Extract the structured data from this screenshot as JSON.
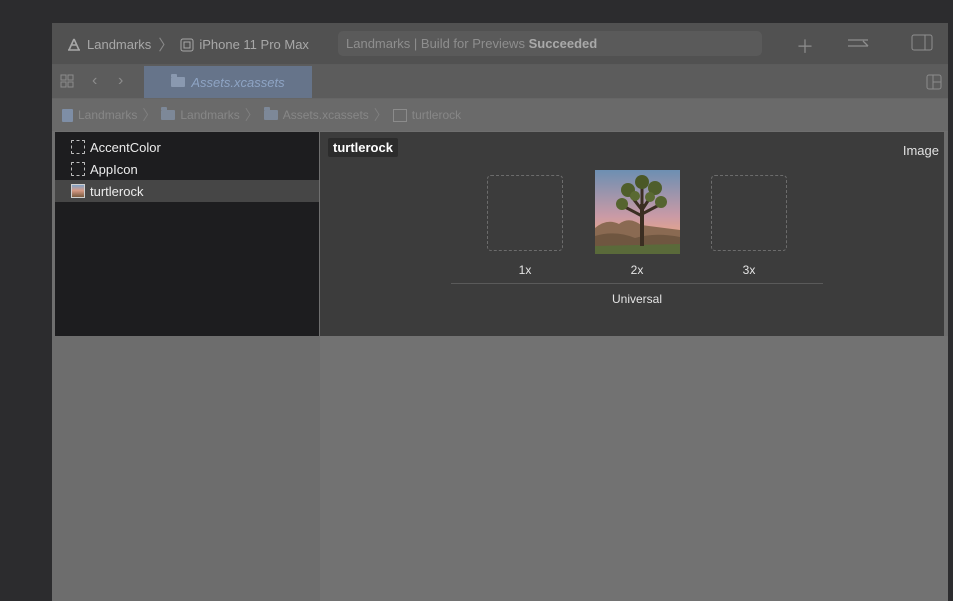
{
  "toolbar": {
    "project": "Landmarks",
    "device": "iPhone 11 Pro Max",
    "status_prefix": "Landmarks | Build for Previews",
    "status_result": "Succeeded",
    "icons": [
      "hammer-icon",
      "device-icon",
      "plus-icon",
      "swap-arrows-icon",
      "panel-toggle-icon"
    ]
  },
  "tabbar": {
    "active_tab": "Assets.xcassets",
    "icons": [
      "grid-icon",
      "back-icon",
      "forward-icon",
      "split-editor-icon"
    ]
  },
  "jumpbar": {
    "crumbs": [
      "Landmarks",
      "Landmarks",
      "Assets.xcassets",
      "turtlerock"
    ]
  },
  "assets": {
    "items": [
      {
        "label": "AccentColor",
        "icon": "color-set-icon"
      },
      {
        "label": "AppIcon",
        "icon": "app-icon-set-icon"
      },
      {
        "label": "turtlerock",
        "icon": "image-set-icon",
        "selected": true
      }
    ]
  },
  "editor": {
    "asset_name": "turtlerock",
    "kind": "Image",
    "slots": [
      "1x",
      "2x",
      "3x"
    ],
    "group": "Universal"
  },
  "colors": {
    "background": "#2c2c2e",
    "sidebar": "#1d1d1f",
    "editor": "#3c3c3c",
    "selection": "#464646",
    "tab_active": "#66748a"
  }
}
